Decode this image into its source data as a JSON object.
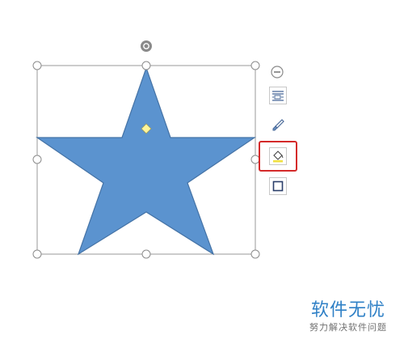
{
  "colors": {
    "star_fill": "#5b93cf",
    "star_stroke": "#4573a6",
    "handle_stroke": "#8c8c8c",
    "adjust_handle": "#fff59a",
    "highlight": "#d42a2a",
    "watermark": "#2f80c6"
  },
  "shape": {
    "type": "five-point-star",
    "selected": true
  },
  "side_toolbar": {
    "items": [
      {
        "icon": "collapse-minus-icon"
      },
      {
        "icon": "layout-options-icon"
      },
      {
        "icon": "shape-style-brush-icon"
      },
      {
        "icon": "fill-bucket-icon",
        "highlighted": true
      },
      {
        "icon": "outline-icon"
      }
    ]
  },
  "watermark": {
    "title": "软件无忧",
    "subtitle": "努力解决软件问题"
  }
}
